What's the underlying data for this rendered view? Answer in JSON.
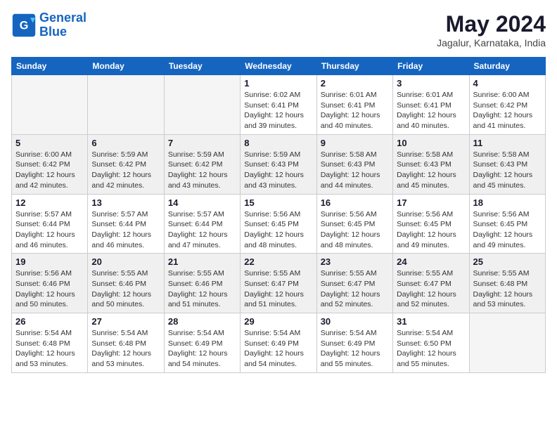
{
  "logo": {
    "line1": "General",
    "line2": "Blue"
  },
  "title": "May 2024",
  "location": "Jagalur, Karnataka, India",
  "weekdays": [
    "Sunday",
    "Monday",
    "Tuesday",
    "Wednesday",
    "Thursday",
    "Friday",
    "Saturday"
  ],
  "weeks": [
    [
      {
        "day": "",
        "empty": true
      },
      {
        "day": "",
        "empty": true
      },
      {
        "day": "",
        "empty": true
      },
      {
        "day": "1",
        "sunrise": "6:02 AM",
        "sunset": "6:41 PM",
        "daylight": "12 hours and 39 minutes."
      },
      {
        "day": "2",
        "sunrise": "6:01 AM",
        "sunset": "6:41 PM",
        "daylight": "12 hours and 40 minutes."
      },
      {
        "day": "3",
        "sunrise": "6:01 AM",
        "sunset": "6:41 PM",
        "daylight": "12 hours and 40 minutes."
      },
      {
        "day": "4",
        "sunrise": "6:00 AM",
        "sunset": "6:42 PM",
        "daylight": "12 hours and 41 minutes."
      }
    ],
    [
      {
        "day": "5",
        "sunrise": "6:00 AM",
        "sunset": "6:42 PM",
        "daylight": "12 hours and 42 minutes."
      },
      {
        "day": "6",
        "sunrise": "5:59 AM",
        "sunset": "6:42 PM",
        "daylight": "12 hours and 42 minutes."
      },
      {
        "day": "7",
        "sunrise": "5:59 AM",
        "sunset": "6:42 PM",
        "daylight": "12 hours and 43 minutes."
      },
      {
        "day": "8",
        "sunrise": "5:59 AM",
        "sunset": "6:43 PM",
        "daylight": "12 hours and 43 minutes."
      },
      {
        "day": "9",
        "sunrise": "5:58 AM",
        "sunset": "6:43 PM",
        "daylight": "12 hours and 44 minutes."
      },
      {
        "day": "10",
        "sunrise": "5:58 AM",
        "sunset": "6:43 PM",
        "daylight": "12 hours and 45 minutes."
      },
      {
        "day": "11",
        "sunrise": "5:58 AM",
        "sunset": "6:43 PM",
        "daylight": "12 hours and 45 minutes."
      }
    ],
    [
      {
        "day": "12",
        "sunrise": "5:57 AM",
        "sunset": "6:44 PM",
        "daylight": "12 hours and 46 minutes."
      },
      {
        "day": "13",
        "sunrise": "5:57 AM",
        "sunset": "6:44 PM",
        "daylight": "12 hours and 46 minutes."
      },
      {
        "day": "14",
        "sunrise": "5:57 AM",
        "sunset": "6:44 PM",
        "daylight": "12 hours and 47 minutes."
      },
      {
        "day": "15",
        "sunrise": "5:56 AM",
        "sunset": "6:45 PM",
        "daylight": "12 hours and 48 minutes."
      },
      {
        "day": "16",
        "sunrise": "5:56 AM",
        "sunset": "6:45 PM",
        "daylight": "12 hours and 48 minutes."
      },
      {
        "day": "17",
        "sunrise": "5:56 AM",
        "sunset": "6:45 PM",
        "daylight": "12 hours and 49 minutes."
      },
      {
        "day": "18",
        "sunrise": "5:56 AM",
        "sunset": "6:45 PM",
        "daylight": "12 hours and 49 minutes."
      }
    ],
    [
      {
        "day": "19",
        "sunrise": "5:56 AM",
        "sunset": "6:46 PM",
        "daylight": "12 hours and 50 minutes."
      },
      {
        "day": "20",
        "sunrise": "5:55 AM",
        "sunset": "6:46 PM",
        "daylight": "12 hours and 50 minutes."
      },
      {
        "day": "21",
        "sunrise": "5:55 AM",
        "sunset": "6:46 PM",
        "daylight": "12 hours and 51 minutes."
      },
      {
        "day": "22",
        "sunrise": "5:55 AM",
        "sunset": "6:47 PM",
        "daylight": "12 hours and 51 minutes."
      },
      {
        "day": "23",
        "sunrise": "5:55 AM",
        "sunset": "6:47 PM",
        "daylight": "12 hours and 52 minutes."
      },
      {
        "day": "24",
        "sunrise": "5:55 AM",
        "sunset": "6:47 PM",
        "daylight": "12 hours and 52 minutes."
      },
      {
        "day": "25",
        "sunrise": "5:55 AM",
        "sunset": "6:48 PM",
        "daylight": "12 hours and 53 minutes."
      }
    ],
    [
      {
        "day": "26",
        "sunrise": "5:54 AM",
        "sunset": "6:48 PM",
        "daylight": "12 hours and 53 minutes."
      },
      {
        "day": "27",
        "sunrise": "5:54 AM",
        "sunset": "6:48 PM",
        "daylight": "12 hours and 53 minutes."
      },
      {
        "day": "28",
        "sunrise": "5:54 AM",
        "sunset": "6:49 PM",
        "daylight": "12 hours and 54 minutes."
      },
      {
        "day": "29",
        "sunrise": "5:54 AM",
        "sunset": "6:49 PM",
        "daylight": "12 hours and 54 minutes."
      },
      {
        "day": "30",
        "sunrise": "5:54 AM",
        "sunset": "6:49 PM",
        "daylight": "12 hours and 55 minutes."
      },
      {
        "day": "31",
        "sunrise": "5:54 AM",
        "sunset": "6:50 PM",
        "daylight": "12 hours and 55 minutes."
      },
      {
        "day": "",
        "empty": true
      }
    ]
  ],
  "labels": {
    "sunrise": "Sunrise:",
    "sunset": "Sunset:",
    "daylight": "Daylight:"
  }
}
